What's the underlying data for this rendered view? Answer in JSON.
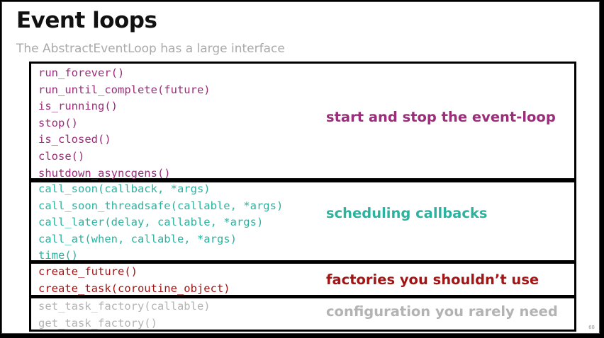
{
  "slide": {
    "title": "Event loops",
    "subtitle": "The AbstractEventLoop has a large interface",
    "page_number": "68"
  },
  "colors": {
    "purple": "#9b2d7a",
    "teal": "#2bb39f",
    "red": "#a31515",
    "gray": "#b3b3b3"
  },
  "groups": [
    {
      "label": "start and stop the event-loop",
      "color": "#9b2d7a",
      "methods": [
        "run_forever()",
        "run_until_complete(future)",
        "is_running()",
        "stop()",
        "is_closed()",
        "close()",
        "shutdown_asyncgens()"
      ]
    },
    {
      "label": "scheduling callbacks",
      "color": "#2bb39f",
      "methods": [
        "call_soon(callback, *args)",
        "call_soon_threadsafe(callable, *args)",
        "call_later(delay, callable, *args)",
        "call_at(when, callable, *args)",
        "time()"
      ]
    },
    {
      "label": "factories you shouldn’t use",
      "color": "#a31515",
      "methods": [
        "create_future()",
        "create_task(coroutine_object)"
      ]
    },
    {
      "label": "configuration you rarely need",
      "color": "#b3b3b3",
      "methods": [
        "set_task_factory(callable)",
        "get_task_factory()"
      ]
    }
  ]
}
